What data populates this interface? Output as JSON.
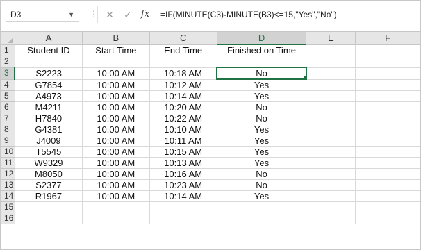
{
  "formula_bar": {
    "name_box": "D3",
    "formula": "=IF(MINUTE(C3)-MINUTE(B3)<=15,\"Yes\",\"No\")",
    "cancel_glyph": "✕",
    "enter_glyph": "✓",
    "fx_label": "fx",
    "dots": "⋮"
  },
  "columns": [
    "A",
    "B",
    "C",
    "D",
    "E",
    "F"
  ],
  "rows": [
    {
      "num": "1",
      "cells": [
        "Student ID",
        "Start Time",
        "End Time",
        "Finished on Time",
        "",
        ""
      ]
    },
    {
      "num": "2",
      "cells": [
        "",
        "",
        "",
        "",
        "",
        ""
      ]
    },
    {
      "num": "3",
      "cells": [
        "S2223",
        "10:00 AM",
        "10:18 AM",
        "No",
        "",
        ""
      ]
    },
    {
      "num": "4",
      "cells": [
        "G7854",
        "10:00 AM",
        "10:12 AM",
        "Yes",
        "",
        ""
      ]
    },
    {
      "num": "5",
      "cells": [
        "A4973",
        "10:00 AM",
        "10:14 AM",
        "Yes",
        "",
        ""
      ]
    },
    {
      "num": "6",
      "cells": [
        "M4211",
        "10:00 AM",
        "10:20 AM",
        "No",
        "",
        ""
      ]
    },
    {
      "num": "7",
      "cells": [
        "H7840",
        "10:00 AM",
        "10:22 AM",
        "No",
        "",
        ""
      ]
    },
    {
      "num": "8",
      "cells": [
        "G4381",
        "10:00 AM",
        "10:10 AM",
        "Yes",
        "",
        ""
      ]
    },
    {
      "num": "9",
      "cells": [
        "J4009",
        "10:00 AM",
        "10:11 AM",
        "Yes",
        "",
        ""
      ]
    },
    {
      "num": "10",
      "cells": [
        "T5545",
        "10:00 AM",
        "10:15 AM",
        "Yes",
        "",
        ""
      ]
    },
    {
      "num": "11",
      "cells": [
        "W9329",
        "10:00 AM",
        "10:13 AM",
        "Yes",
        "",
        ""
      ]
    },
    {
      "num": "12",
      "cells": [
        "M8050",
        "10:00 AM",
        "10:16 AM",
        "No",
        "",
        ""
      ]
    },
    {
      "num": "13",
      "cells": [
        "S2377",
        "10:00 AM",
        "10:23 AM",
        "No",
        "",
        ""
      ]
    },
    {
      "num": "14",
      "cells": [
        "R1967",
        "10:00 AM",
        "10:14 AM",
        "Yes",
        "",
        ""
      ]
    },
    {
      "num": "15",
      "cells": [
        "",
        "",
        "",
        "",
        "",
        ""
      ]
    },
    {
      "num": "16",
      "cells": [
        "",
        "",
        "",
        "",
        "",
        ""
      ]
    }
  ],
  "selection": {
    "row": "3",
    "col": "D"
  },
  "colors": {
    "accent": "#217346",
    "header_bg": "#e6e6e6",
    "gridline": "#d9d9d9"
  }
}
